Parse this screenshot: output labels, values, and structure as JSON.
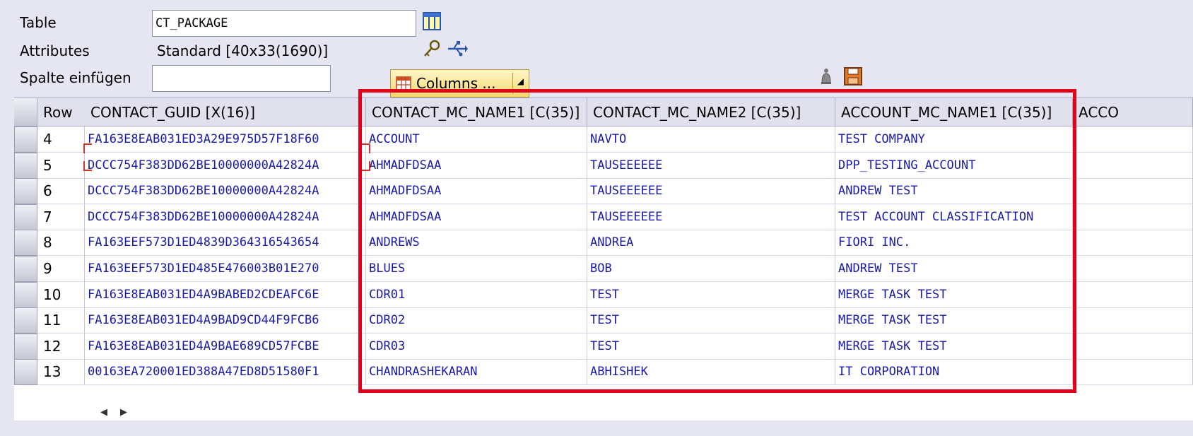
{
  "form": {
    "table_label": "Table",
    "table_value": "CT_PACKAGE",
    "attributes_label": "Attributes",
    "attributes_value": "Standard [40x33(1690)]",
    "insert_label": "Spalte einfügen",
    "insert_value": "",
    "columns_button": "Columns ..."
  },
  "grid": {
    "headers": [
      "Row",
      "CONTACT_GUID [X(16)]",
      "CONTACT_MC_NAME1 [C(35)]",
      "CONTACT_MC_NAME2 [C(35)]",
      "ACCOUNT_MC_NAME1 [C(35)]",
      "ACCO"
    ],
    "rows": [
      [
        "4",
        "FA163E8EAB031ED3A29E975D57F18F60",
        "ACCOUNT",
        "NAVTO",
        "TEST COMPANY"
      ],
      [
        "5",
        "DCCC754F383DD62BE10000000A42824A",
        "AHMADFDSAA",
        "TAUSEEEEEE",
        "DPP_TESTING_ACCOUNT"
      ],
      [
        "6",
        "DCCC754F383DD62BE10000000A42824A",
        "AHMADFDSAA",
        "TAUSEEEEEE",
        "ANDREW TEST"
      ],
      [
        "7",
        "DCCC754F383DD62BE10000000A42824A",
        "AHMADFDSAA",
        "TAUSEEEEEE",
        "TEST ACCOUNT CLASSIFICATION"
      ],
      [
        "8",
        "FA163EEF573D1ED4839D364316543654",
        "ANDREWS",
        "ANDREA",
        "FIORI INC."
      ],
      [
        "9",
        "FA163EEF573D1ED485E476003B01E270",
        "BLUES",
        "BOB",
        "ANDREW TEST"
      ],
      [
        "10",
        "FA163E8EAB031ED4A9BABED2CDEAFC6E",
        "CDR01",
        "TEST",
        "MERGE TASK TEST"
      ],
      [
        "11",
        "FA163E8EAB031ED4A9BAD9CD44F9FCB6",
        "CDR02",
        "TEST",
        "MERGE TASK TEST"
      ],
      [
        "12",
        "FA163E8EAB031ED4A9BAE689CD57FCBE",
        "CDR03",
        "TEST",
        "MERGE TASK TEST"
      ],
      [
        "13",
        "00163EA720001ED388A47ED8D51580F1",
        "CHANDRASHEKARAN",
        "ABHISHEK",
        "IT CORPORATION"
      ]
    ]
  },
  "icons": {
    "table_view": "table-layout-icon",
    "keys": "key-icon",
    "usb": "usb-icon",
    "bell": "bell-icon",
    "save": "save-icon",
    "grid": "grid-icon"
  },
  "colors": {
    "background": "#e6e5f2",
    "cell_text": "#1a1aa8",
    "highlight": "#e2001a"
  }
}
